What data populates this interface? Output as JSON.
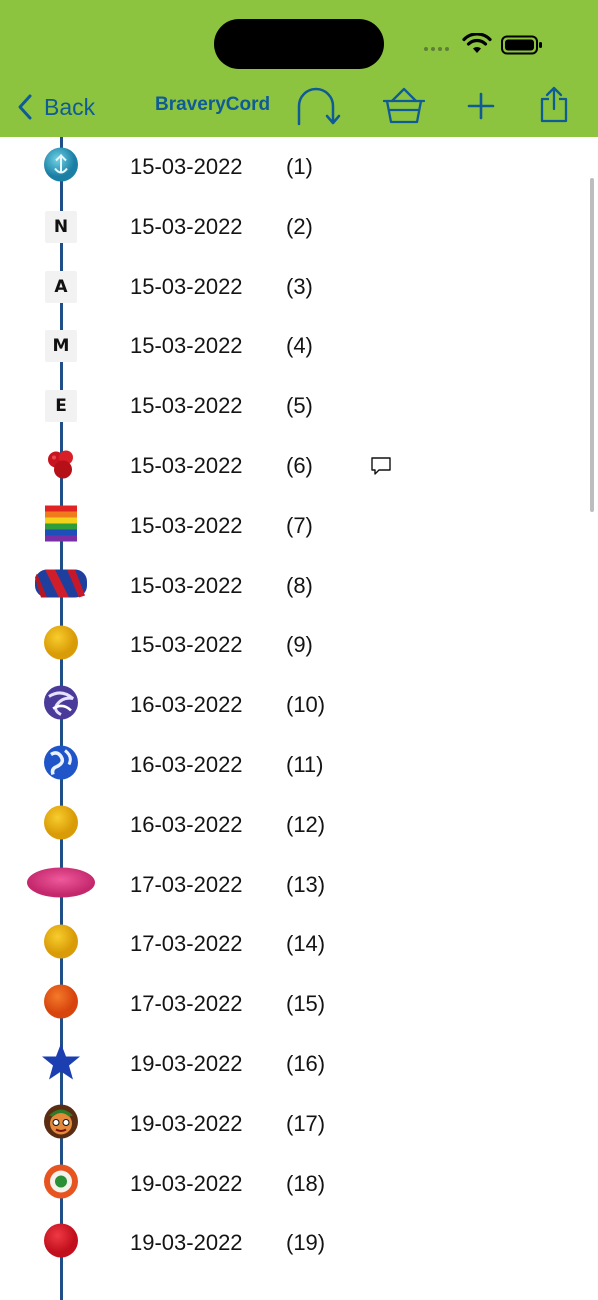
{
  "nav": {
    "back_label": "Back",
    "title": "BraveryCord"
  },
  "colors": {
    "header_bg": "#8cc43f",
    "accent": "#0f5b96",
    "cord": "#1f4f86"
  },
  "beads": [
    {
      "date": "15-03-2022",
      "num": "(1)",
      "kind": "ornament-blue"
    },
    {
      "date": "15-03-2022",
      "num": "(2)",
      "kind": "letter",
      "letter": "N"
    },
    {
      "date": "15-03-2022",
      "num": "(3)",
      "kind": "letter",
      "letter": "A"
    },
    {
      "date": "15-03-2022",
      "num": "(4)",
      "kind": "letter",
      "letter": "M"
    },
    {
      "date": "15-03-2022",
      "num": "(5)",
      "kind": "letter",
      "letter": "E"
    },
    {
      "date": "15-03-2022",
      "num": "(6)",
      "kind": "clover-red",
      "comment": true
    },
    {
      "date": "15-03-2022",
      "num": "(7)",
      "kind": "rainbow"
    },
    {
      "date": "15-03-2022",
      "num": "(8)",
      "kind": "twist-red-blue"
    },
    {
      "date": "15-03-2022",
      "num": "(9)",
      "kind": "ball-yellow"
    },
    {
      "date": "16-03-2022",
      "num": "(10)",
      "kind": "swirl-purple"
    },
    {
      "date": "16-03-2022",
      "num": "(11)",
      "kind": "marble-blue"
    },
    {
      "date": "16-03-2022",
      "num": "(12)",
      "kind": "ball-yellow"
    },
    {
      "date": "17-03-2022",
      "num": "(13)",
      "kind": "oval-pink"
    },
    {
      "date": "17-03-2022",
      "num": "(14)",
      "kind": "ball-yellow"
    },
    {
      "date": "17-03-2022",
      "num": "(15)",
      "kind": "ball-orange"
    },
    {
      "date": "19-03-2022",
      "num": "(16)",
      "kind": "star-blue"
    },
    {
      "date": "19-03-2022",
      "num": "(17)",
      "kind": "face"
    },
    {
      "date": "19-03-2022",
      "num": "(18)",
      "kind": "target"
    },
    {
      "date": "19-03-2022",
      "num": "(19)",
      "kind": "ball-red"
    }
  ]
}
